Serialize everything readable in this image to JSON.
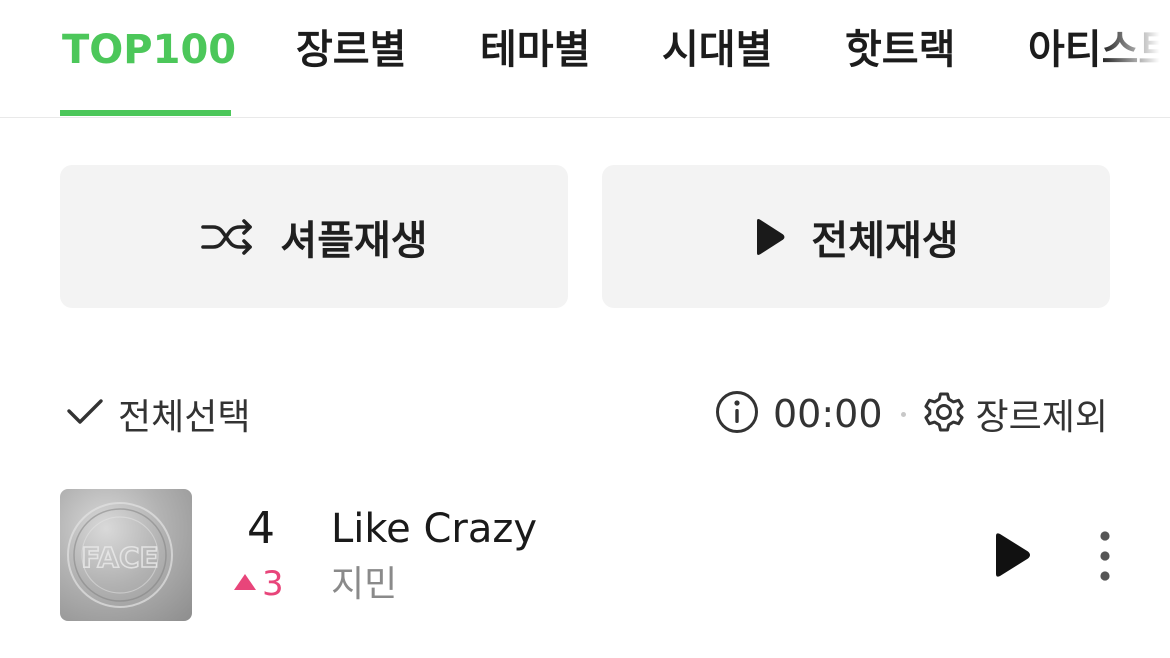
{
  "tabs": [
    {
      "label": "TOP100",
      "active": true
    },
    {
      "label": "장르별",
      "active": false
    },
    {
      "label": "테마별",
      "active": false
    },
    {
      "label": "시대별",
      "active": false
    },
    {
      "label": "핫트랙",
      "active": false
    },
    {
      "label": "아티스트",
      "active": false
    }
  ],
  "actions": {
    "shuffle_label": "셔플재생",
    "shuffle_icon": "shuffle-icon",
    "play_all_label": "전체재생",
    "play_all_icon": "play-icon"
  },
  "toolbar": {
    "select_all_label": "전체선택",
    "select_all_icon": "check-icon",
    "info_icon": "info-icon",
    "timer": "00:00",
    "exclude_label": "장르제외",
    "exclude_icon": "gear-icon"
  },
  "track": {
    "rank": "4",
    "rank_change": "3",
    "rank_direction": "up",
    "title": "Like Crazy",
    "artist": "지민",
    "album_art_text": "FACE"
  },
  "colors": {
    "accent": "#4cc75a",
    "rank_up": "#e8457a",
    "button_bg": "#f3f3f3",
    "artist_text": "#8a8a8a"
  }
}
